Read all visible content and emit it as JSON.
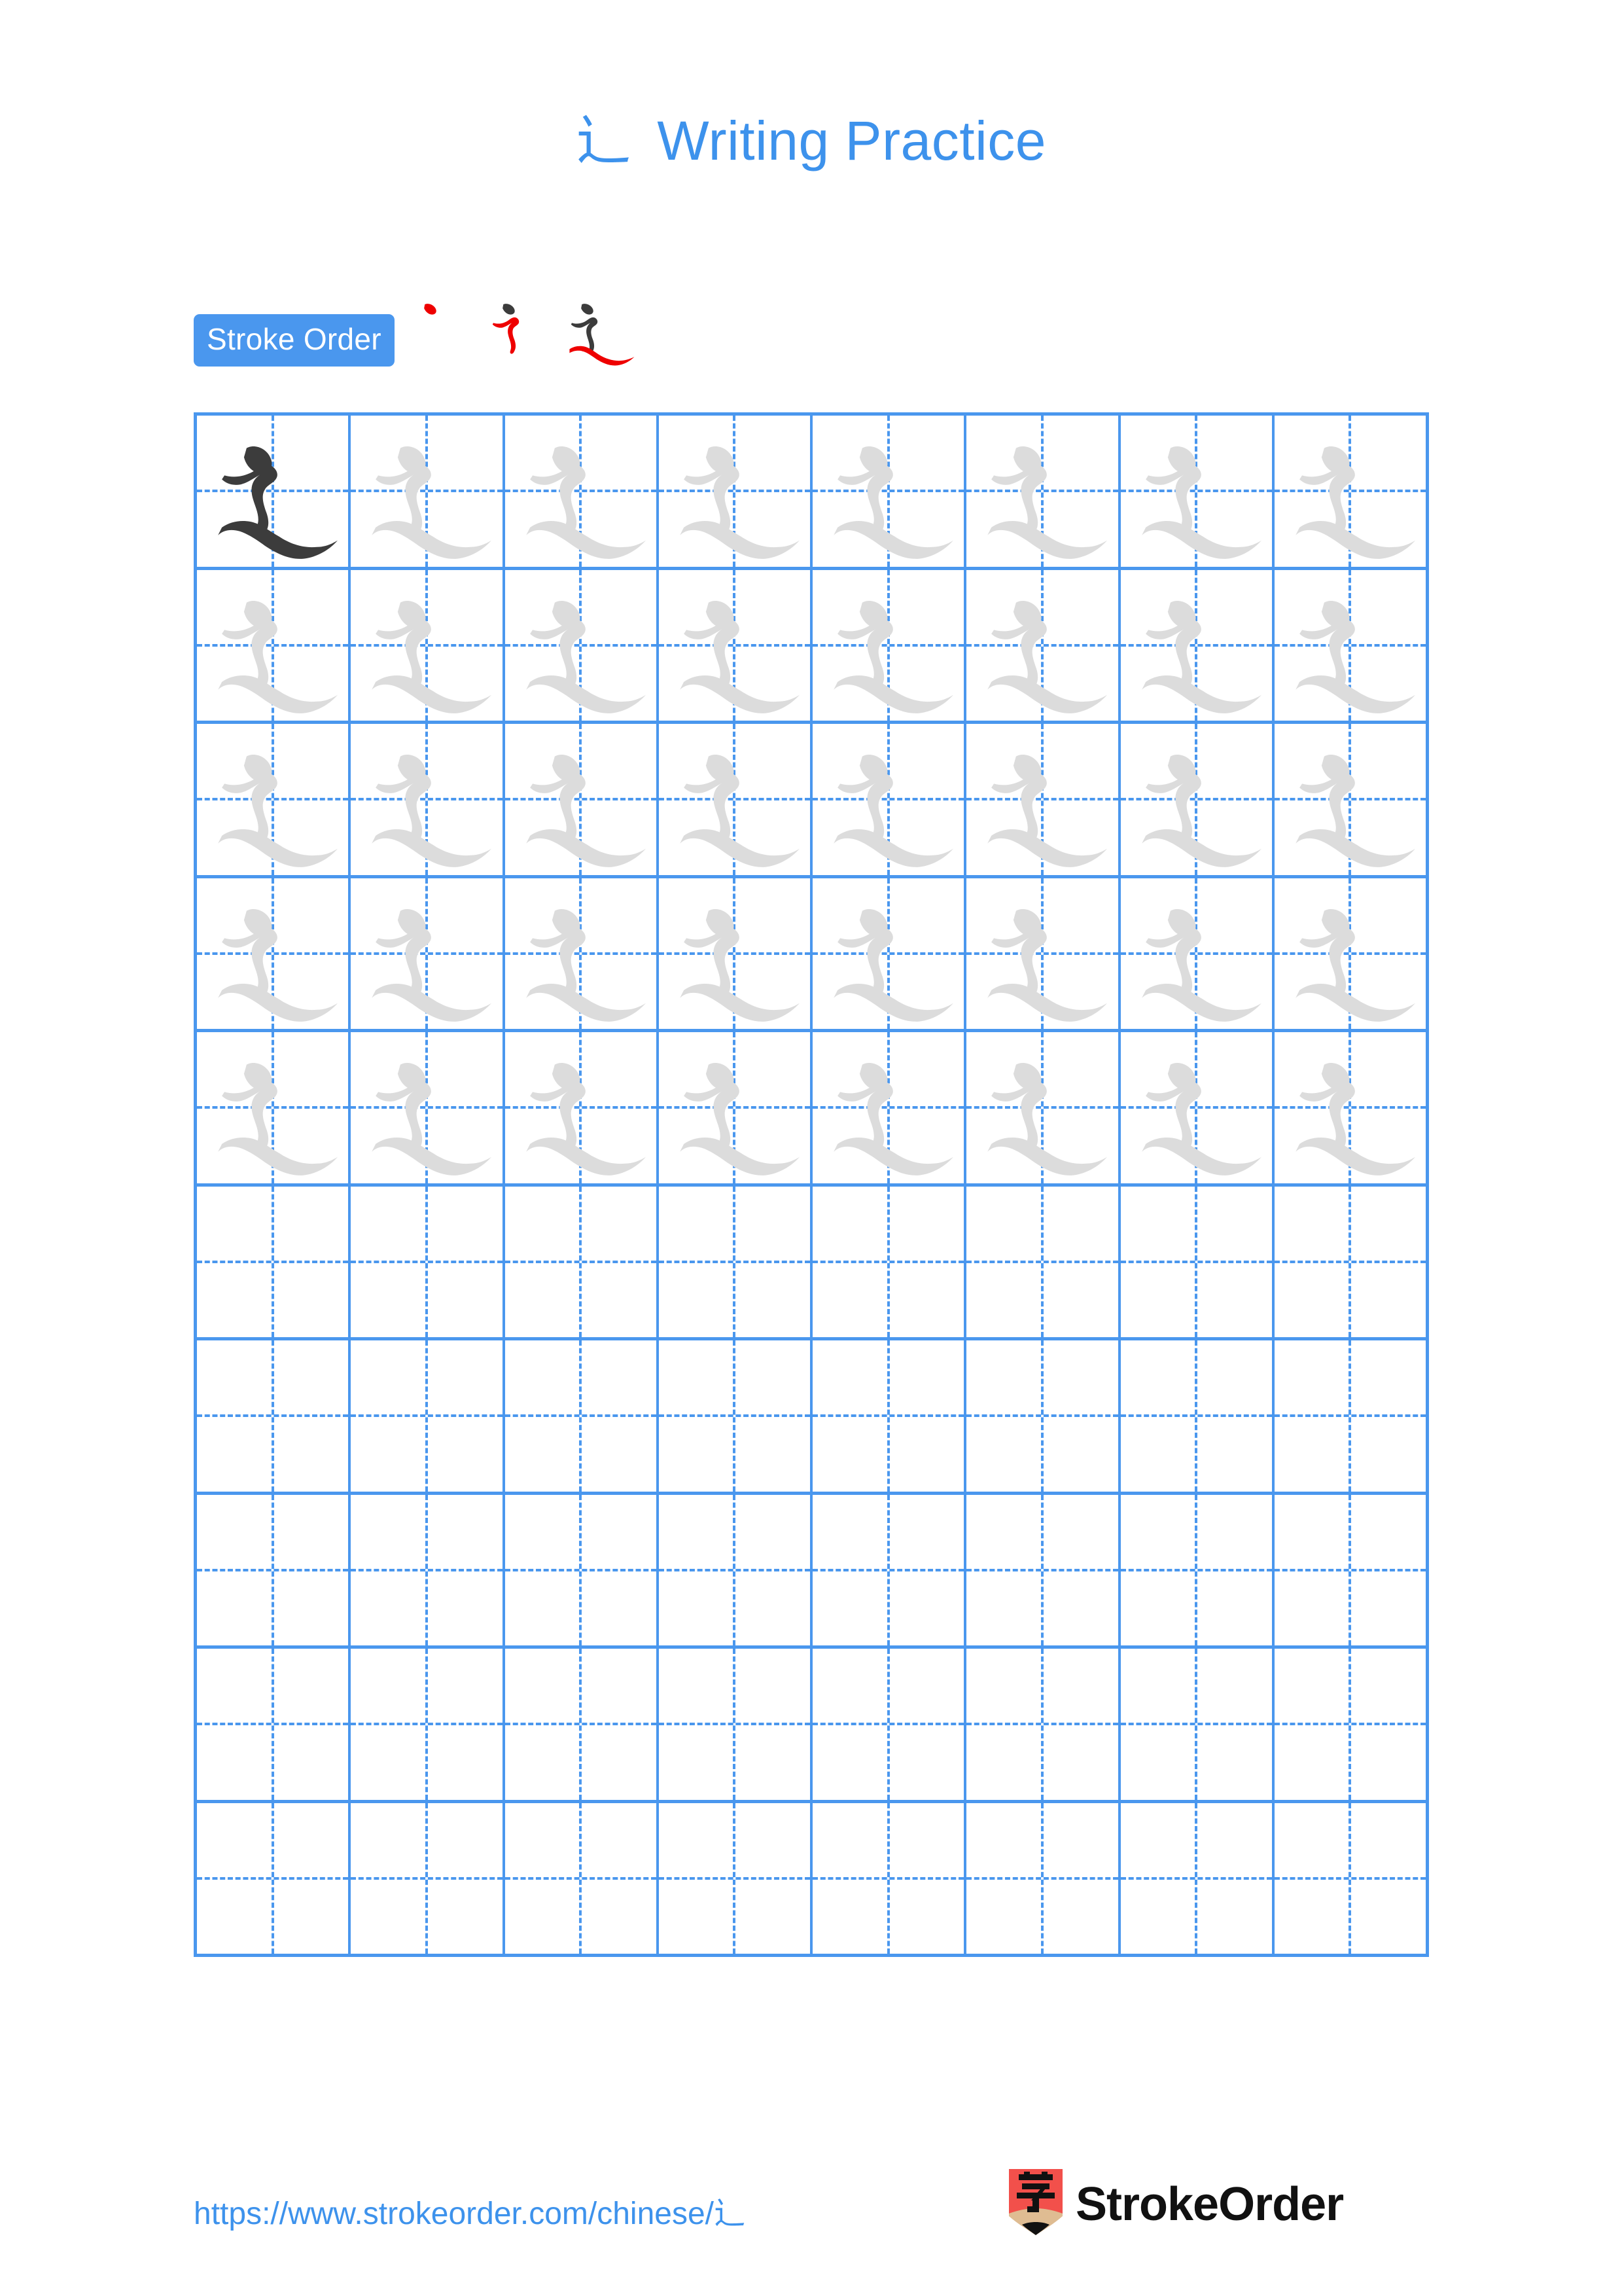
{
  "character": "辶",
  "title": {
    "char": "辶",
    "text": " Writing Practice",
    "full": "辶 Writing Practice",
    "color": "#3D92EC"
  },
  "stroke_order": {
    "badge_label": "Stroke Order",
    "badge_bg": "#4A97EE",
    "badge_text_color": "#FFFFFF",
    "total_strokes": 3,
    "new_stroke_color": "#EE0000",
    "done_stroke_color": "#3C3C3C",
    "steps": [
      {
        "index": 1,
        "strokes_shown": 1,
        "new_stroke": "dot"
      },
      {
        "index": 2,
        "strokes_shown": 2,
        "new_stroke": "horizontal-fold-vertical-hook"
      },
      {
        "index": 3,
        "strokes_shown": 3,
        "new_stroke": "level-press-sweep"
      }
    ]
  },
  "grid": {
    "columns": 8,
    "rows": 10,
    "line_color": "#4A97EE",
    "dark_glyph_color": "#3C3C3C",
    "trace_glyph_color": "#DCDCDC",
    "filled_rows": 5,
    "dark_cells": [
      {
        "row": 1,
        "col": 1
      }
    ],
    "row_fill": [
      "traced",
      "traced",
      "traced",
      "traced",
      "traced",
      "empty",
      "empty",
      "empty",
      "empty",
      "empty"
    ]
  },
  "footer": {
    "url": "https://www.strokeorder.com/chinese/辶",
    "url_color": "#3D92EC",
    "brand_name": "StrokeOrder",
    "logo": {
      "body_color": "#F2504B",
      "wood_color": "#DFBC92",
      "tip_color": "#111111",
      "glyph": "字",
      "glyph_color": "#111111"
    }
  }
}
